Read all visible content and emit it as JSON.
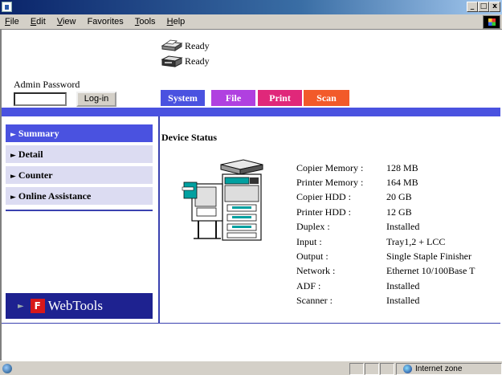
{
  "menubar": {
    "items": [
      {
        "key": "F",
        "rest": "ile"
      },
      {
        "key": "E",
        "rest": "dit"
      },
      {
        "key": "V",
        "rest": "iew"
      },
      {
        "key": "",
        "rest": "Favorites",
        "pre": "F",
        "label_full": "Favorites"
      },
      {
        "key": "T",
        "rest": "ools"
      },
      {
        "key": "H",
        "rest": "elp"
      }
    ]
  },
  "window": {
    "minimize": "_",
    "maximize": "□",
    "close": "x"
  },
  "status": [
    {
      "text": "Ready",
      "icon": "printer-icon"
    },
    {
      "text": "Ready",
      "icon": "copier-icon"
    }
  ],
  "admin": {
    "label": "Admin Password",
    "password_value": "",
    "login_label": "Log-in"
  },
  "tabs": [
    {
      "label": "System",
      "color": "#4a52e0"
    },
    {
      "label": "File",
      "color": "#b040e0"
    },
    {
      "label": "Print",
      "color": "#e0287a"
    },
    {
      "label": "Scan",
      "color": "#f25a2a"
    }
  ],
  "nav": [
    {
      "label": "Summary",
      "active": true
    },
    {
      "label": "Detail",
      "active": false
    },
    {
      "label": "Counter",
      "active": false
    },
    {
      "label": "Online Assistance",
      "active": false
    }
  ],
  "webtools": {
    "label": "WebTools",
    "logo_text": "fiery"
  },
  "main": {
    "title": "Device Status",
    "specs": [
      {
        "k": "Copier Memory :",
        "v": "128 MB"
      },
      {
        "k": "Printer Memory :",
        "v": "164 MB"
      },
      {
        "k": "Copier HDD :",
        "v": "20 GB"
      },
      {
        "k": "Printer HDD :",
        "v": "12 GB"
      },
      {
        "k": "Duplex :",
        "v": "Installed"
      },
      {
        "k": "Input :",
        "v": "Tray1,2 + LCC"
      },
      {
        "k": "Output :",
        "v": "Single Staple Finisher"
      },
      {
        "k": "Network :",
        "v": "Ethernet 10/100Base T"
      },
      {
        "k": "ADF :",
        "v": "Installed"
      },
      {
        "k": "Scanner :",
        "v": "Installed"
      }
    ]
  },
  "statusbar": {
    "zone": "Internet zone"
  }
}
